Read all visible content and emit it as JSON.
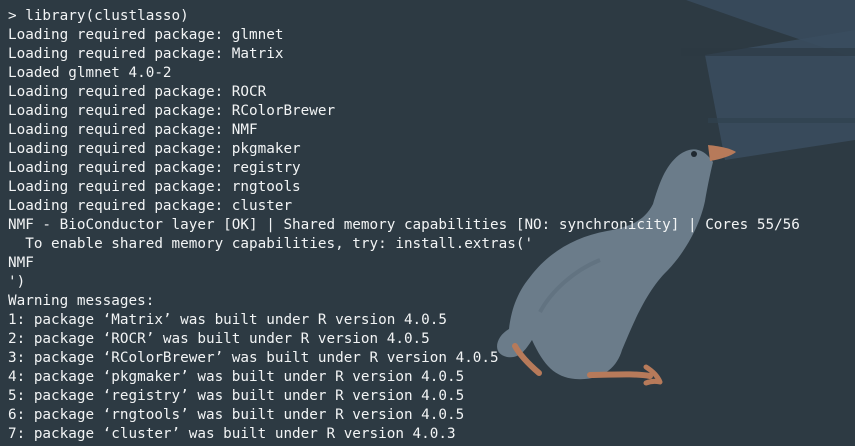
{
  "terminal": {
    "lines": [
      "",
      "> library(clustlasso)",
      "Loading required package: glmnet",
      "Loading required package: Matrix",
      "Loaded glmnet 4.0-2",
      "Loading required package: ROCR",
      "Loading required package: RColorBrewer",
      "Loading required package: NMF",
      "Loading required package: pkgmaker",
      "Loading required package: registry",
      "Loading required package: rngtools",
      "Loading required package: cluster",
      "NMF - BioConductor layer [OK] | Shared memory capabilities [NO: synchronicity] | Cores 55/56",
      "  To enable shared memory capabilities, try: install.extras('",
      "NMF",
      "')",
      "Warning messages:",
      "1: package ‘Matrix’ was built under R version 4.0.5",
      "2: package ‘ROCR’ was built under R version 4.0.5",
      "3: package ‘RColorBrewer’ was built under R version 4.0.5",
      "4: package ‘pkgmaker’ was built under R version 4.0.5",
      "5: package ‘registry’ was built under R version 4.0.5",
      "6: package ‘rngtools’ was built under R version 4.0.5",
      "7: package ‘cluster’ was built under R version 4.0.3",
      ""
    ]
  },
  "wallpaper": {
    "background_color": "#2d3a43",
    "text_color": "#f2f4f5",
    "goose_body_color": "#6b7c8a",
    "goose_beak_color": "#b77a5a",
    "window_panel_color": "#394b5d"
  }
}
